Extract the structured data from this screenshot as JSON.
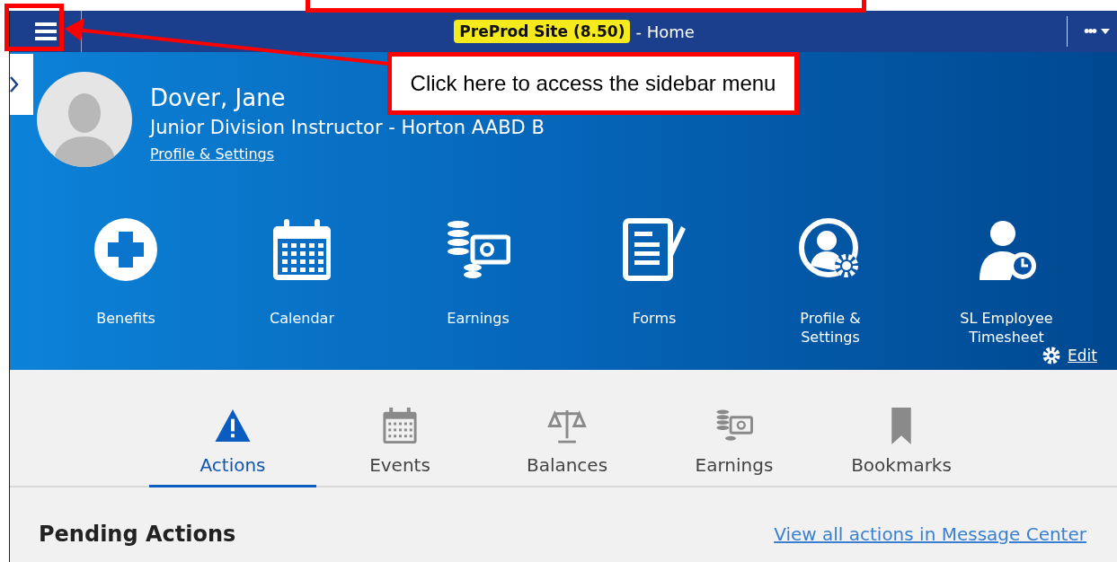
{
  "header": {
    "site_badge": "PreProd Site (8.50)",
    "page_title": "- Home",
    "more": "•••"
  },
  "callout": {
    "text": "Click here to access the sidebar menu"
  },
  "profile": {
    "name": "Dover, Jane",
    "role": "Junior Division Instructor - Horton AABD B",
    "link": "Profile & Settings"
  },
  "quick_links": [
    {
      "kind": "benefits",
      "label": "Benefits"
    },
    {
      "kind": "calendar",
      "label": "Calendar"
    },
    {
      "kind": "earnings",
      "label": "Earnings"
    },
    {
      "kind": "forms",
      "label": "Forms"
    },
    {
      "kind": "profile",
      "label": "Profile & Settings"
    },
    {
      "kind": "timesheet",
      "label": "SL Employee Timesheet"
    }
  ],
  "edit": "Edit",
  "tabs": [
    {
      "kind": "actions",
      "label": "Actions",
      "selected": true
    },
    {
      "kind": "events",
      "label": "Events",
      "selected": false
    },
    {
      "kind": "balances",
      "label": "Balances",
      "selected": false
    },
    {
      "kind": "earnings",
      "label": "Earnings",
      "selected": false
    },
    {
      "kind": "bookmarks",
      "label": "Bookmarks",
      "selected": false
    }
  ],
  "section": {
    "title": "Pending Actions",
    "link": "View all actions in Message Center"
  }
}
